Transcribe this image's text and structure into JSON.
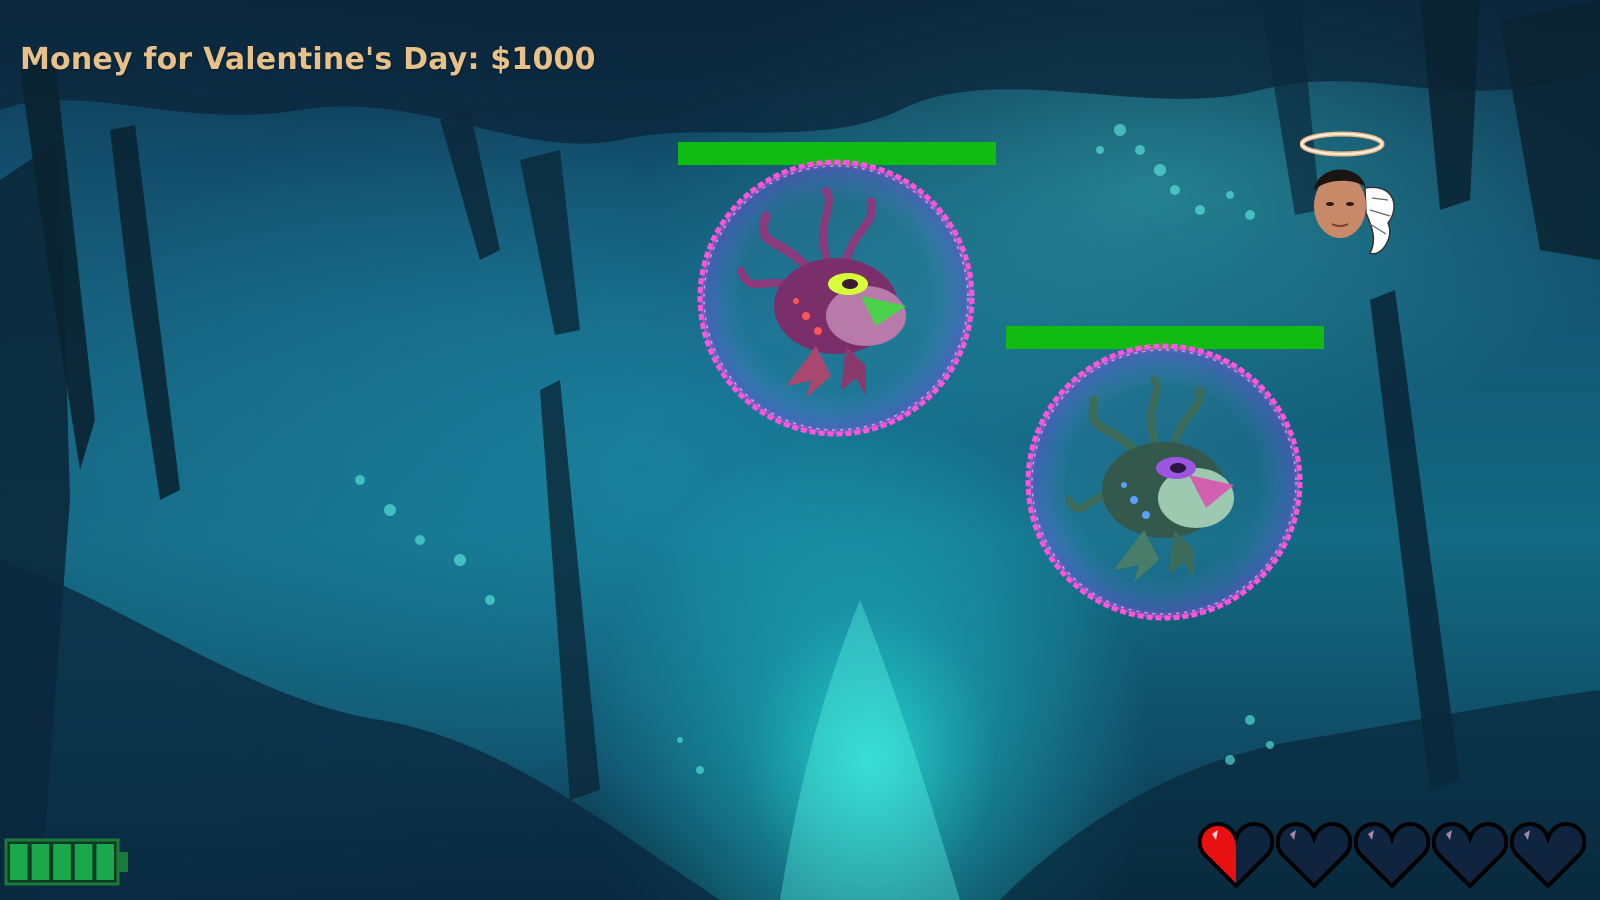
{
  "hud": {
    "money_label": "Money for Valentine's Day: $1000"
  },
  "enemies": [
    {
      "name": "Purple Tentacle Toad",
      "health": 1.0,
      "bubble_color": "#ff44d8",
      "body_color": "#7a2f6a"
    },
    {
      "name": "Green Tentacle Toad",
      "health": 1.0,
      "bubble_color": "#ff44d8",
      "body_color": "#3d6b5a"
    }
  ],
  "player": {
    "icon": "angel-head-icon"
  },
  "energy": {
    "icon": "battery-icon",
    "segments_total": 5,
    "segments_filled": 5,
    "color": "#1aa64a"
  },
  "lives": {
    "icon": "heart-icon",
    "total": 5,
    "filled": 0.5,
    "color_full": "#e81010"
  }
}
